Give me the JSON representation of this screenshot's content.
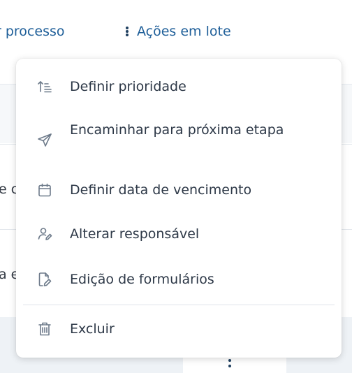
{
  "toolbar": {
    "process_label": "r processo",
    "batch_actions_label": "Ações em lote"
  },
  "background_table": {
    "row1_fragment": "e c",
    "row2_fragment": "a e"
  },
  "menu": {
    "items": [
      {
        "label": "Definir prioridade",
        "icon": "sort-priority-icon"
      },
      {
        "label": "Encaminhar para próxima etapa",
        "icon": "send-icon"
      },
      {
        "label": "Definir data de vencimento",
        "icon": "calendar-icon"
      },
      {
        "label": "Alterar responsável",
        "icon": "user-edit-icon"
      },
      {
        "label": "Edição de formulários",
        "icon": "form-edit-icon"
      },
      {
        "label": "Excluir",
        "icon": "trash-icon"
      }
    ]
  },
  "colors": {
    "link": "#1f5f99",
    "menu_text": "#2d3847",
    "icon": "#6d7a8a"
  }
}
